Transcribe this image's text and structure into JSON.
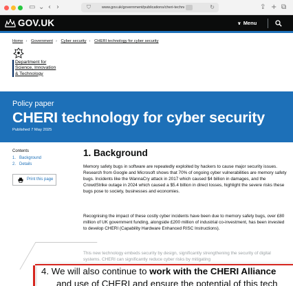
{
  "browser": {
    "url": "www.gov.uk/government/publications/cheri-technology-...",
    "reload_icon": "reload-icon",
    "share_icon": "share-icon",
    "new_tab_icon": "plus-icon",
    "tabs_icon": "tabs-icon"
  },
  "header": {
    "logo": "GOV.UK",
    "menu_label": "Menu"
  },
  "breadcrumbs": [
    {
      "label": "Home"
    },
    {
      "label": "Government"
    },
    {
      "label": "Cyber security"
    },
    {
      "label": "CHERI technology for cyber security"
    }
  ],
  "organisation": {
    "line1": "Department for",
    "line2": "Science, Innovation",
    "line3": "& Technology"
  },
  "title_band": {
    "kicker": "Policy paper",
    "title": "CHERI technology for cyber security",
    "published": "Published 7 May 2025"
  },
  "contents": {
    "heading": "Contents",
    "items": [
      {
        "num": "1.",
        "label": "Background"
      },
      {
        "num": "2.",
        "label": "Details"
      }
    ],
    "print_label": "Print this page"
  },
  "main": {
    "heading": "1. Background",
    "p1": "Memory safety bugs in software are repeatedly exploited by hackers to cause major security issues. Research from Google and Microsoft shows that 70% of ongoing cyber vulnerabilities are memory safety bugs. Incidents like the WannaCry attack in 2017 which caused $4 billion in damages, and the CrowdStrike outage in 2024 which caused a $5.4 billion in direct losses, highlight the severe risks these bugs pose to society, businesses and economies.",
    "p2": "Recognising the impact of these costly cyber incidents have been due to memory safety bugs, over £80 million of UK government funding, alongside £200 million of industrial co-investment, has been invested to develop CHERI (Capability Hardware Enhanced RISC Instructions).",
    "p3": "This new technology embeds security by design, significantly strengthening the security of digital systems. CHERI can significantly reduce cyber risks by mitigating"
  },
  "zoom": {
    "prefix": "4. We will also continue to ",
    "bold": "work with the CHERI Alliance",
    "line2": "and use of CHERI and ensure the potential of this tech"
  },
  "colors": {
    "header_bg": "#0b0c0c",
    "band_bg": "#1d70b8",
    "link": "#1d70b8",
    "accent_red": "#d6251e"
  }
}
